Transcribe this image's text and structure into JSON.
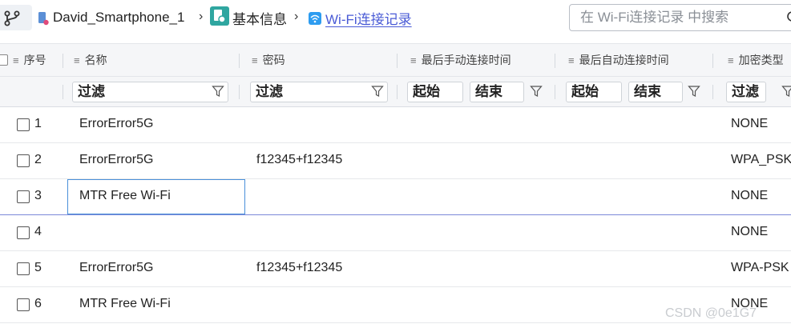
{
  "breadcrumb": {
    "device": "David_Smartphone_1",
    "section": "基本信息",
    "page": "Wi-Fi连接记录",
    "separator": "›"
  },
  "search": {
    "placeholder": "在 Wi-Fi连接记录 中搜索"
  },
  "table": {
    "columns": [
      "序号",
      "名称",
      "密码",
      "最后手动连接时间",
      "最后自动连接时间",
      "加密类型"
    ],
    "filters": {
      "text": "过滤",
      "start": "起始",
      "end": "结束"
    },
    "rows": [
      {
        "index": "1",
        "name": "ErrorError5G",
        "password": "",
        "manual_time": "",
        "auto_time": "",
        "encryption": "NONE"
      },
      {
        "index": "2",
        "name": "ErrorError5G",
        "password": "f12345+f12345",
        "manual_time": "",
        "auto_time": "",
        "encryption": "WPA_PSK"
      },
      {
        "index": "3",
        "name": "MTR Free Wi-Fi",
        "password": "",
        "manual_time": "",
        "auto_time": "",
        "encryption": "NONE"
      },
      {
        "index": "4",
        "name": "",
        "password": "",
        "manual_time": "",
        "auto_time": "",
        "encryption": "NONE"
      },
      {
        "index": "5",
        "name": "ErrorError5G",
        "password": "f12345+f12345",
        "manual_time": "",
        "auto_time": "",
        "encryption": "WPA-PSK"
      },
      {
        "index": "6",
        "name": "MTR Free Wi-Fi",
        "password": "",
        "manual_time": "",
        "auto_time": "",
        "encryption": "NONE"
      }
    ]
  },
  "watermark": "CSDN @0e1G7",
  "colors": {
    "link": "#4a5bd6",
    "info_icon": "#2fa6a0",
    "wifi_icon": "#2d9cf0",
    "selection": "#4a90d9"
  }
}
